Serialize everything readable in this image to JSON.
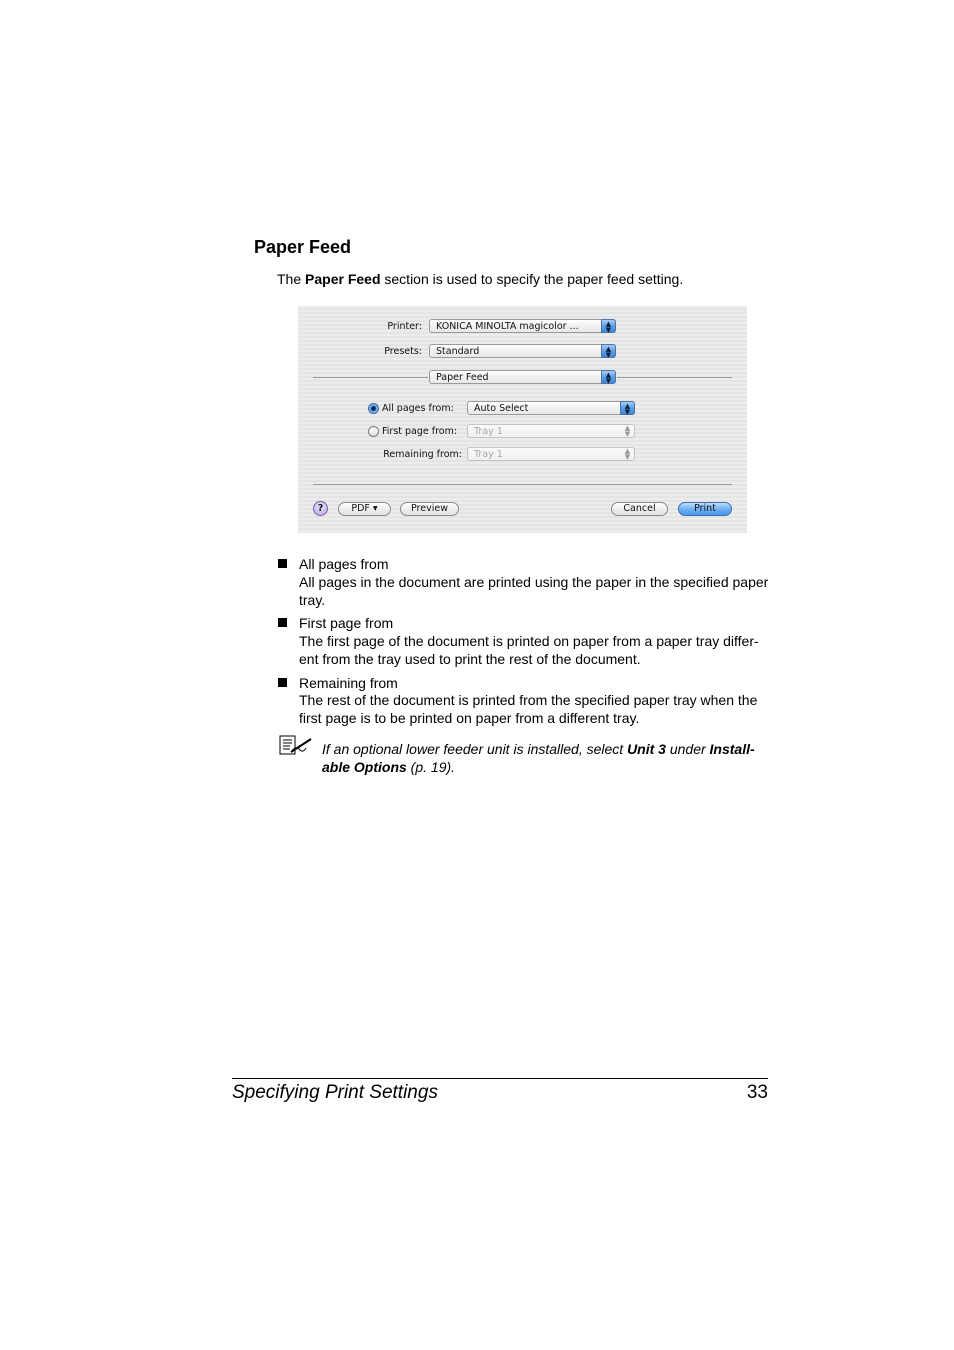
{
  "page": {
    "heading": "Paper Feed",
    "intro": {
      "before": "The ",
      "bold": "Paper Feed",
      "after": " section is used to specify the paper feed setting."
    }
  },
  "dialog": {
    "printer_label": "Printer:",
    "printer_value": "KONICA MINOLTA magicolor ...",
    "presets_label": "Presets:",
    "presets_value": "Standard",
    "panel_value": "Paper Feed",
    "options": [
      {
        "label": "All pages from:",
        "value": "Auto Select",
        "selected": true,
        "enabled": true
      },
      {
        "label": "First page from:",
        "value": "Tray 1",
        "selected": false,
        "enabled": false
      },
      {
        "label": "Remaining from:",
        "value": "Tray 1",
        "enabled": false
      }
    ],
    "help_label": "?",
    "pdf_label": "PDF ▾",
    "preview_label": "Preview",
    "cancel_label": "Cancel",
    "print_label": "Print",
    "popup_arrows": "▲▼"
  },
  "bullets": [
    {
      "title": "All pages from",
      "description": "All pages in the document are printed using the paper in the specified paper tray."
    },
    {
      "title": "First page from",
      "description": "The first page of the document is printed on paper from a paper tray differ-ent from the tray used to print the rest of the document."
    },
    {
      "title": "Remaining from",
      "description": "The rest of the document is printed from the specified paper tray when the first page is to be printed on paper from a different tray."
    }
  ],
  "note": {
    "t1": "If an optional lower feeder unit is installed, select ",
    "b1": "Unit 3",
    "t2": " under ",
    "b2": "Install-able Options",
    "t3": " (p. 19)."
  },
  "footer": {
    "title": "Specifying Print Settings",
    "page_number": "33"
  }
}
